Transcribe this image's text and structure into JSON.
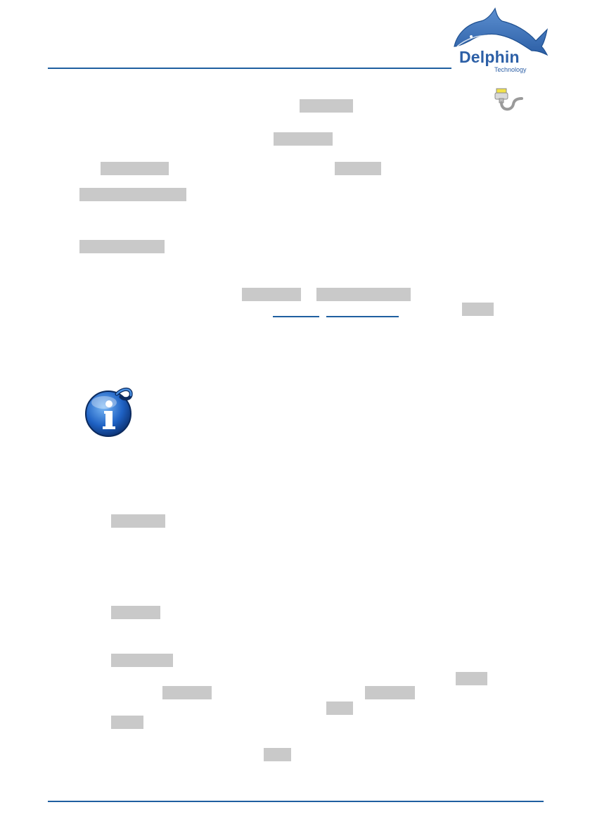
{
  "logo": {
    "name": "Delphin",
    "tagline": "Technology",
    "icon": "dolphin-logo",
    "brand_color": "#2c5fa6"
  },
  "icons": {
    "connection": "cable-plug-icon",
    "info": "info-icon"
  },
  "colors": {
    "rule": "#1f5fa0",
    "highlight": "#c9c9c9",
    "link": "#1f5fa0"
  },
  "highlights": {
    "h1": "",
    "h2": "",
    "h3": "",
    "h4": "",
    "h5": "",
    "h6": "",
    "h7": "",
    "h8": "",
    "h9": "",
    "h10": "",
    "h11": "",
    "h12": "",
    "h13": "",
    "h14": "",
    "h15": "",
    "h16": "",
    "h17": "",
    "h18": "",
    "h19": "",
    "h20": ""
  }
}
